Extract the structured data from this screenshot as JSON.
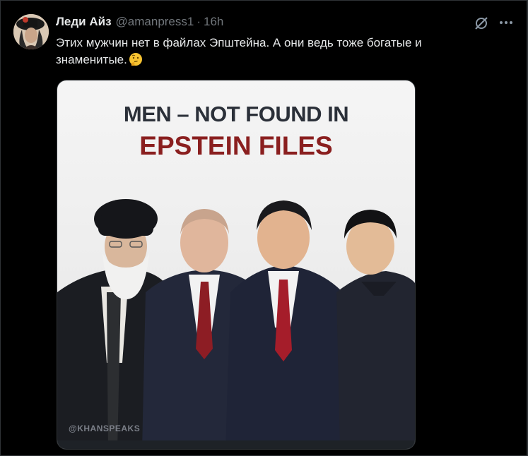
{
  "post": {
    "author_name": "Леди Айз",
    "handle": "@amanpress1",
    "separator": "·",
    "time": "16h",
    "text": "Этих мужчин нет в файлах Эпштейна. А они ведь тоже богатые и знаменитые.",
    "emoji_icon": "thinking-face-icon",
    "grok_icon": "grok-icon",
    "more_icon": "more-icon"
  },
  "media": {
    "headline_line1": "MEN – NOT FOUND IN",
    "headline_line2": "EPSTEIN FILES",
    "watermark": "@KHANSPEAKS",
    "headline_color": "#2b3039",
    "accent_color": "#8a1f1f"
  }
}
